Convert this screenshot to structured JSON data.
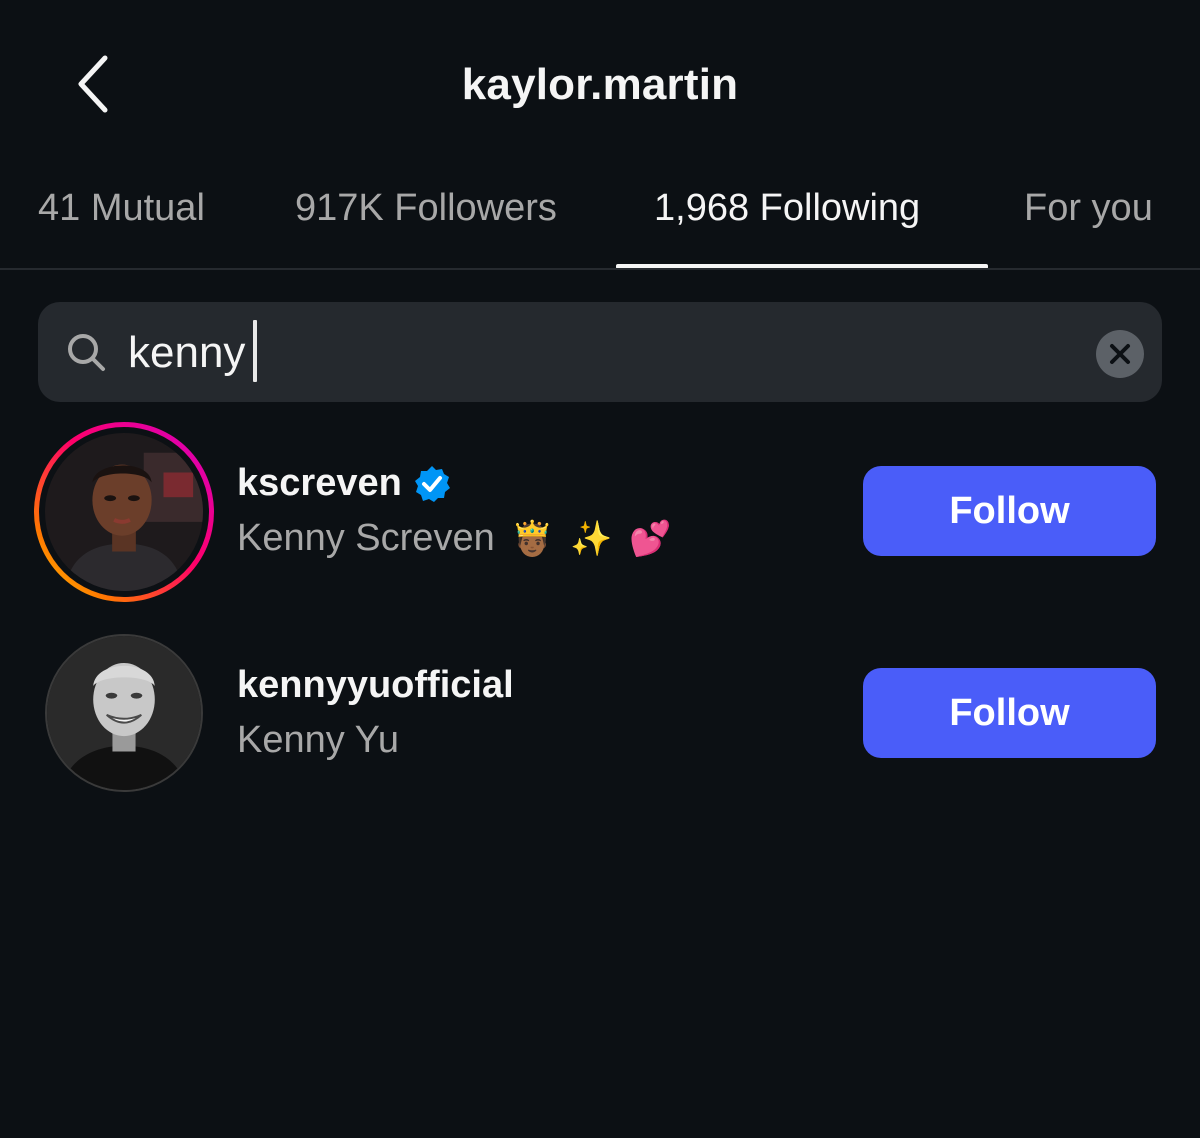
{
  "header": {
    "title": "kaylor.martin",
    "back_icon": "chevron-left-icon"
  },
  "tabs": [
    {
      "label": "41 Mutual",
      "active": false
    },
    {
      "label": "917K Followers",
      "active": false
    },
    {
      "label": "1,968 Following",
      "active": true
    },
    {
      "label": "For you",
      "active": false
    }
  ],
  "search": {
    "value": "kenny",
    "search_icon": "search-icon",
    "clear_icon": "clear-icon"
  },
  "results": [
    {
      "username": "kscreven",
      "full_name": "Kenny Screven",
      "emojis": [
        "🤴🏾",
        "✨",
        "💕"
      ],
      "verified": true,
      "has_story_ring": true,
      "button_label": "Follow"
    },
    {
      "username": "kennyyuofficial",
      "full_name": "Kenny Yu",
      "emojis": [],
      "verified": false,
      "has_story_ring": false,
      "button_label": "Follow"
    }
  ],
  "colors": {
    "background": "#0c1014",
    "follow_button": "#4a5df9",
    "verified_badge": "#0095f6",
    "secondary_text": "#a8a8a8"
  }
}
